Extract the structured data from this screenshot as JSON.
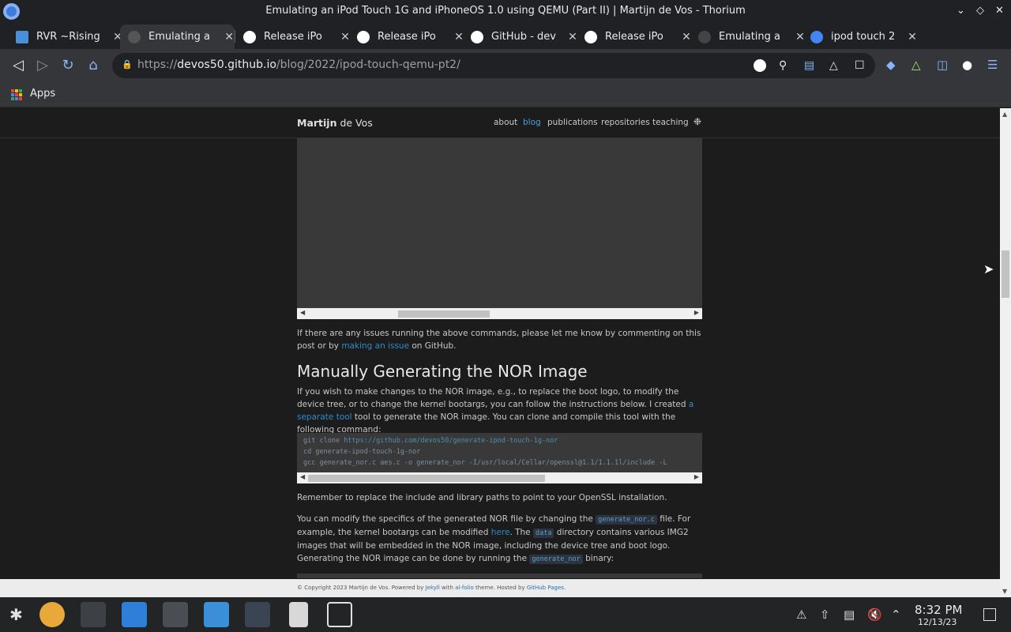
{
  "window": {
    "title": "Emulating an iPod Touch 1G and iPhoneOS 1.0 using QEMU (Part II) | Martijn de Vos - Thorium"
  },
  "tabs": [
    {
      "label": "RVR ~Rising",
      "favicon_color": "#4a90d9",
      "active": false
    },
    {
      "label": "Emulating a",
      "favicon_color": "#666666",
      "active": true
    },
    {
      "label": "Release iPo",
      "favicon_color": "#ffffff",
      "active": false
    },
    {
      "label": "Release iPo",
      "favicon_color": "#ffffff",
      "active": false
    },
    {
      "label": "GitHub - dev",
      "favicon_color": "#ffffff",
      "active": false
    },
    {
      "label": "Release iPo",
      "favicon_color": "#ffffff",
      "active": false
    },
    {
      "label": "Emulating a",
      "favicon_color": "#444444",
      "active": false
    },
    {
      "label": "ipod touch 2",
      "favicon_color": "#4285f4",
      "active": false
    }
  ],
  "toolbar": {
    "url_scheme": "https://",
    "url_host": "devos50.github.io",
    "url_path": "/blog/2022/ipod-touch-qemu-pt2/"
  },
  "bookmarks": {
    "apps_label": "Apps"
  },
  "site": {
    "brand_first": "Martijn",
    "brand_last": " de Vos",
    "nav": [
      "about",
      "blog",
      "publications",
      "repositories",
      "teaching"
    ],
    "nav_active": "blog"
  },
  "article": {
    "p1_before": "If there are any issues running the above commands, please let me know by commenting on this post or by ",
    "p1_link": "making an issue",
    "p1_after": " on GitHub.",
    "heading": "Manually Generating the NOR Image",
    "p2_before": "If you wish to make changes to the NOR image, e.g., to replace the boot logo, to modify the device tree, or to change the kernel bootargs, you can follow the instructions below. I created ",
    "p2_link": "a separate tool",
    "p2_after": " tool to generate the NOR image. You can clone and compile this tool with the following command:",
    "code_lines": [
      [
        "git clone ",
        "https://github.com/devos50/generate-ipod-touch-1g-nor"
      ],
      [
        "cd generate-ipod-touch-1g-nor",
        ""
      ],
      [
        "gcc generate_nor.c aes.c -o generate_nor -I/usr/local/Cellar/openssl@1.1/1.1.1l/include -L",
        ""
      ]
    ],
    "p3": "Remember to replace the include and library paths to point to your OpenSSL installation.",
    "p4_a": "You can modify the specifics of the generated NOR file by changing the ",
    "p4_code1": "generate_nor.c",
    "p4_b": " file. For example, the kernel bootargs can be modified ",
    "p4_link": "here",
    "p4_c": ". The ",
    "p4_code2": "data",
    "p4_d": " directory contains various IMG2 images that will be embedded in the NOR image, including the device tree and boot logo. Generating the NOR image can be done by running the ",
    "p4_code3": "generate_nor",
    "p4_e": " binary:"
  },
  "footer": {
    "text_before": "© Copyright 2023 Martijn de Vos. Powered by ",
    "jekyll": "Jekyll",
    "text_mid": " with ",
    "alfolio": "al-folio",
    "text_mid2": " theme. Hosted by ",
    "ghpages": "GitHub Pages",
    "text_end": "."
  },
  "taskbar": {
    "time": "8:32 PM",
    "date": "12/13/23"
  }
}
